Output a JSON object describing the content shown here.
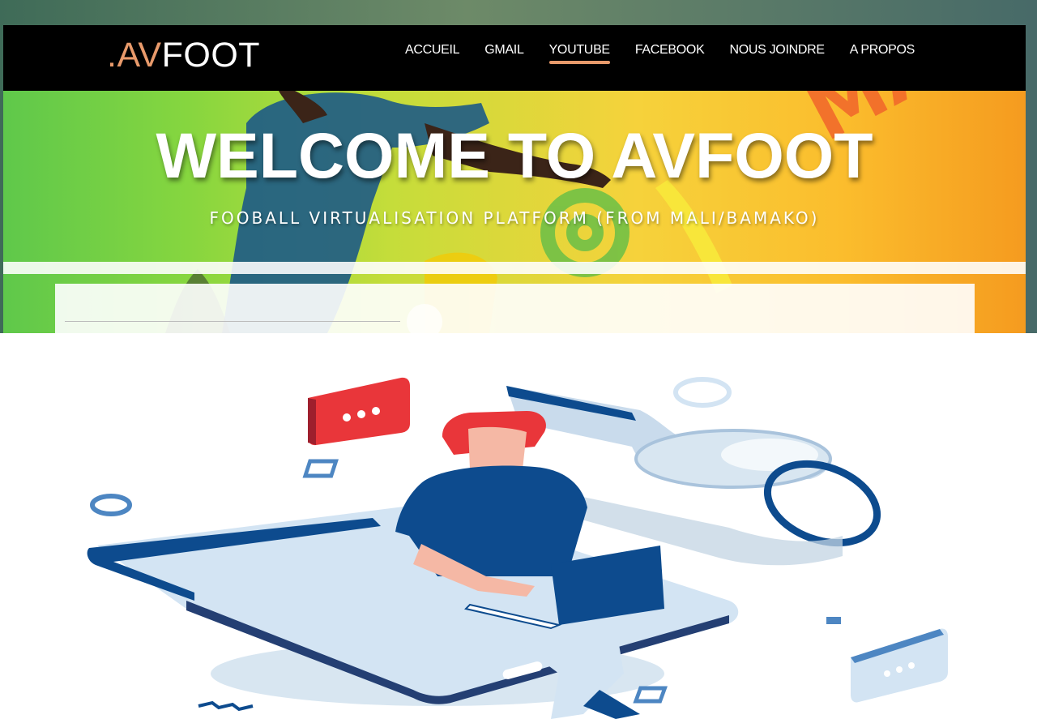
{
  "theme": {
    "accent": "#e89a6b",
    "nav_bg": "#000000",
    "text": "#ffffff"
  },
  "header": {
    "logo_prefix": ".AV",
    "logo_suffix": "FOOT",
    "nav": [
      {
        "label": "ACCUEIL",
        "active": false
      },
      {
        "label": "GMAIL",
        "active": false
      },
      {
        "label": "YOUTUBE",
        "active": true
      },
      {
        "label": "FACEBOOK",
        "active": false
      },
      {
        "label": "NOUS JOINDRE",
        "active": false
      },
      {
        "label": "A PROPOS",
        "active": false
      }
    ]
  },
  "hero": {
    "title": "WELCOME TO AVFOOT",
    "subtitle": "FOOBALL VIRTUALISATION PLATFORM (FROM MALI/BAMAKO)",
    "background_text": "MALI"
  },
  "illustration": {
    "name": "person-with-laptop-on-phone-and-key",
    "colors": {
      "navy": "#0d4b8e",
      "light_blue": "#d3e4f3",
      "red": "#e9363a",
      "skin": "#f5b8a5"
    }
  }
}
